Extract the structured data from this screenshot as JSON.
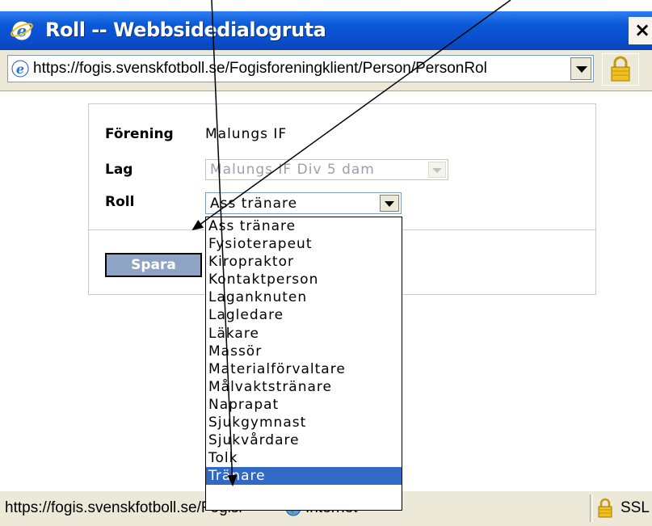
{
  "window": {
    "title": "Roll -- Webbsidedialogruta",
    "close_label": "×"
  },
  "address_bar": {
    "url": "https://fogis.svenskfotboll.se/Fogisforeningklient/Person/PersonRol"
  },
  "form": {
    "forening_label": "Förening",
    "forening_value": "Malungs IF",
    "lag_label": "Lag",
    "lag_value": "Malungs IF Div 5 dam",
    "roll_label": "Roll",
    "roll_value": "Ass tränare",
    "save_label": "Spara"
  },
  "roll_options": [
    "Ass tränare",
    "Fysioterapeut",
    "Kiropraktor",
    "Kontaktperson",
    "Laganknuten",
    "Lagledare",
    "Läkare",
    "Massör",
    "Materialförvaltare",
    "Målvaktstränare",
    "Naprapat",
    "Sjukgymnast",
    "Sjukvårdare",
    "Tolk",
    "Tränare"
  ],
  "selected_option_index": 14,
  "status_bar": {
    "url_text": "https://fogis.svenskfotboll.se/Fogisr",
    "zone_text": "Internet",
    "ssl_text": "SSL"
  },
  "colors": {
    "titlebar": "#0a58d6",
    "selection": "#316ac5",
    "save_button": "#8fa3c4",
    "annotation_arrows": "#000000"
  }
}
